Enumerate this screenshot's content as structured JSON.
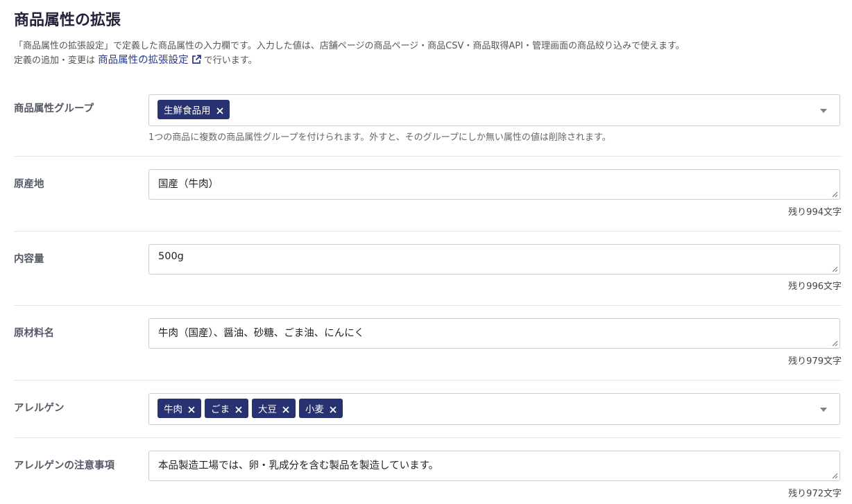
{
  "page": {
    "title": "商品属性の拡張",
    "description_line1": "「商品属性の拡張設定」で定義した商品属性の入力欄です。入力した値は、店舗ページの商品ページ・商品CSV・商品取得API・管理画面の商品絞り込みで使えます。",
    "description_line2_prefix": "定義の追加・変更は",
    "description_link": "商品属性の拡張設定",
    "description_line2_suffix": "で行います。"
  },
  "fields": {
    "group": {
      "label": "商品属性グループ",
      "tags": [
        "生鮮食品用"
      ],
      "help": "1つの商品に複数の商品属性グループを付けられます。外すと、そのグループにしか無い属性の値は削除されます。"
    },
    "origin": {
      "label": "原産地",
      "value": "国産（牛肉）",
      "remaining": "残り994文字"
    },
    "volume": {
      "label": "内容量",
      "value": "500g",
      "remaining": "残り996文字"
    },
    "ingredients": {
      "label": "原材料名",
      "value": "牛肉（国産）、醤油、砂糖、ごま油、にんにく",
      "remaining": "残り979文字"
    },
    "allergen": {
      "label": "アレルゲン",
      "tags": [
        "牛肉",
        "ごま",
        "大豆",
        "小麦"
      ]
    },
    "allergen_note": {
      "label": "アレルゲンの注意事項",
      "value": "本品製造工場では、卵・乳成分を含む製品を製造しています。",
      "remaining": "残り972文字"
    }
  },
  "icons": {
    "external_link": "external-link-icon",
    "remove": "close-icon",
    "dropdown": "chevron-down-icon",
    "resize": "resize-handle-icon"
  },
  "colors": {
    "tag_bg": "#283270",
    "link": "#2b3a8a",
    "title": "#22223b"
  }
}
